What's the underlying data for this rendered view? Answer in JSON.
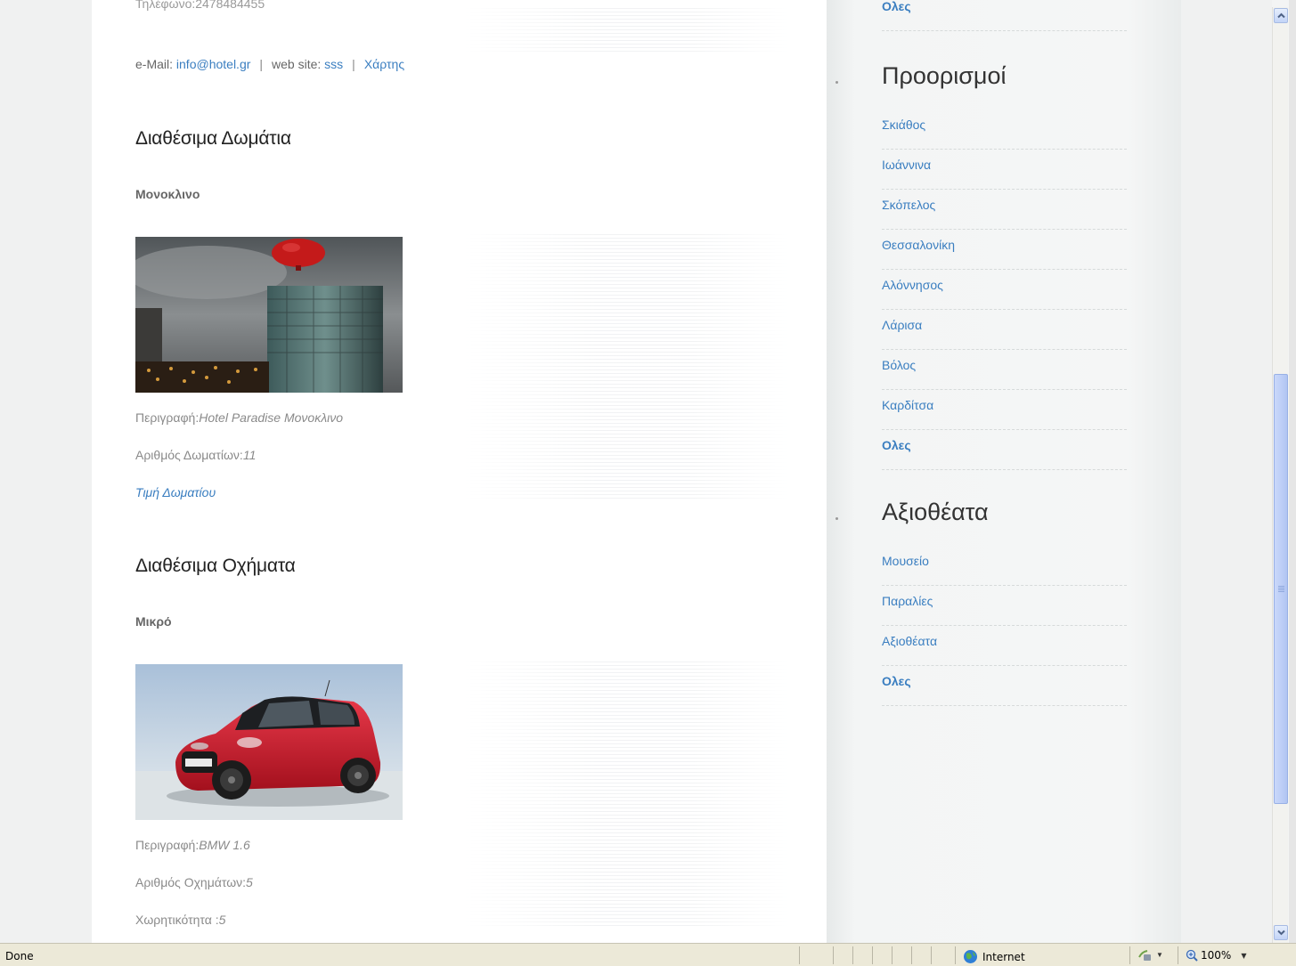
{
  "header_cut": {
    "phone": "Τηλέφωνο:2478484455"
  },
  "contact": {
    "email_label": "e-Mail:",
    "email": "info@hotel.gr",
    "sep1": "|",
    "web_label": "web site:",
    "web": "sss",
    "sep2": "|",
    "map": "Χάρτης"
  },
  "rooms": {
    "title": "Διαθέσιμα Δωμάτια",
    "item_name": "Μονοκλινο",
    "description_label": "Περιγραφή:",
    "description": "Hotel Paradise Μονοκλινο",
    "count_label": "Αριθμός Δωματίων:",
    "count": "11",
    "price_link": "Τιμή Δωματίου"
  },
  "vehicles": {
    "title": "Διαθέσιμα Οχήματα",
    "item_name": "Μικρό",
    "description_label": "Περιγραφή:",
    "description": "BMW 1.6",
    "count_label": "Αριθμός Οχημάτων:",
    "count": "5",
    "capacity_label": "Χωρητικότητα :",
    "capacity": "5"
  },
  "sidebar": {
    "top_cut_link": "Ολες",
    "destinations": {
      "title": "Προορισμοί",
      "items": [
        "Σκιάθος",
        "Ιωάννινα",
        "Σκόπελος",
        "Θεσσαλονίκη",
        "Αλόννησος",
        "Λάρισα",
        "Βόλος",
        "Καρδίτσα",
        "Ολες"
      ]
    },
    "sights": {
      "title": "Αξιοθέατα",
      "items": [
        "Μουσείο",
        "Παραλίες",
        "Αξιοθέατα",
        "Ολες"
      ]
    }
  },
  "statusbar": {
    "status": "Done",
    "zone": "Internet",
    "zoom": "100%"
  },
  "colors": {
    "link": "#3a7ec0",
    "scroll_thumb": "#bccdf6",
    "statusbar_bg": "#ece9d8"
  }
}
